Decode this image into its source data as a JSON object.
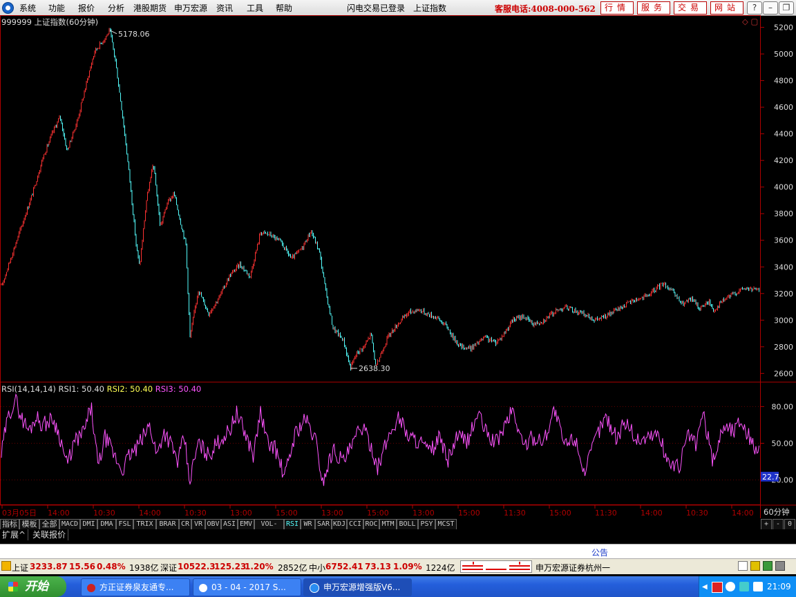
{
  "menu": [
    "系统",
    "功能",
    "报价",
    "分析",
    "港股期货",
    "申万宏源",
    "资讯",
    "工具",
    "帮助"
  ],
  "login_status": "闪电交易已登录",
  "index_name": "上证指数",
  "hotline": "客服电话:4008-000-562",
  "top_buttons": [
    "行情",
    "服务",
    "交易",
    "网站"
  ],
  "window_buttons": [
    "?",
    "–",
    "❐",
    "✕"
  ],
  "chart_title": "999999 上证指数(60分钟)",
  "max_marker": "5178.06",
  "min_marker": "2638.30",
  "period_label": "60分钟",
  "rsi_readout": {
    "name": "RSI(14,14,14)",
    "r1": "RSI1: 50.40",
    "r2": "RSI2: 50.40",
    "r3": "RSI3: 50.40"
  },
  "rsi_current": "22.7",
  "colors": {
    "up": "#ff3232",
    "down": "#54ffff",
    "rsi": "#ff54ff",
    "axis": "#b00000",
    "rsi2": "#ffff54"
  },
  "chart_data": {
    "type": "line",
    "price_ylim": [
      2550,
      5260
    ],
    "price_ticks": [
      "5200",
      "5000",
      "4800",
      "4600",
      "4400",
      "4200",
      "4000",
      "3800",
      "3600",
      "3400",
      "3200",
      "3000",
      "2800",
      "2600"
    ],
    "rsi_ylim": [
      0,
      100
    ],
    "rsi_ticks": [
      "80.00",
      "50.00",
      "20.00"
    ],
    "x_tick_labels": [
      "03月05日",
      "14:00",
      "10:30",
      "14:00",
      "10:30",
      "13:00",
      "15:00",
      "13:00",
      "15:00",
      "13:00",
      "15:00",
      "11:30",
      "15:00",
      "11:30",
      "14:00",
      "10:30",
      "14:00"
    ],
    "price_keypoints": [
      [
        0,
        3250
      ],
      [
        12,
        3440
      ],
      [
        30,
        3720
      ],
      [
        45,
        3950
      ],
      [
        60,
        4220
      ],
      [
        75,
        4420
      ],
      [
        85,
        4530
      ],
      [
        95,
        4270
      ],
      [
        110,
        4500
      ],
      [
        125,
        4820
      ],
      [
        135,
        5020
      ],
      [
        150,
        5120
      ],
      [
        157,
        5178
      ],
      [
        165,
        4950
      ],
      [
        175,
        4550
      ],
      [
        185,
        4100
      ],
      [
        195,
        3570
      ],
      [
        200,
        3400
      ],
      [
        210,
        3900
      ],
      [
        220,
        4180
      ],
      [
        230,
        3700
      ],
      [
        240,
        3880
      ],
      [
        250,
        3950
      ],
      [
        260,
        3720
      ],
      [
        267,
        3570
      ],
      [
        273,
        2870
      ],
      [
        285,
        3230
      ],
      [
        300,
        3050
      ],
      [
        315,
        3170
      ],
      [
        330,
        3330
      ],
      [
        345,
        3420
      ],
      [
        360,
        3330
      ],
      [
        375,
        3660
      ],
      [
        390,
        3640
      ],
      [
        405,
        3580
      ],
      [
        420,
        3460
      ],
      [
        435,
        3540
      ],
      [
        448,
        3670
      ],
      [
        460,
        3520
      ],
      [
        470,
        3200
      ],
      [
        480,
        2940
      ],
      [
        495,
        2850
      ],
      [
        505,
        2640
      ],
      [
        515,
        2760
      ],
      [
        525,
        2800
      ],
      [
        535,
        2900
      ],
      [
        542,
        2640
      ],
      [
        550,
        2760
      ],
      [
        560,
        2880
      ],
      [
        575,
        2980
      ],
      [
        590,
        3060
      ],
      [
        605,
        3080
      ],
      [
        615,
        3050
      ],
      [
        630,
        3020
      ],
      [
        645,
        2950
      ],
      [
        655,
        2860
      ],
      [
        665,
        2800
      ],
      [
        680,
        2790
      ],
      [
        700,
        2870
      ],
      [
        715,
        2830
      ],
      [
        725,
        2880
      ],
      [
        740,
        3000
      ],
      [
        755,
        3030
      ],
      [
        770,
        2970
      ],
      [
        785,
        3000
      ],
      [
        800,
        3060
      ],
      [
        815,
        3100
      ],
      [
        830,
        3070
      ],
      [
        845,
        3040
      ],
      [
        860,
        3000
      ],
      [
        875,
        3030
      ],
      [
        895,
        3090
      ],
      [
        915,
        3150
      ],
      [
        935,
        3180
      ],
      [
        958,
        3280
      ],
      [
        970,
        3220
      ],
      [
        985,
        3120
      ],
      [
        1000,
        3160
      ],
      [
        1010,
        3090
      ],
      [
        1025,
        3140
      ],
      [
        1030,
        3070
      ],
      [
        1045,
        3150
      ],
      [
        1060,
        3200
      ],
      [
        1075,
        3240
      ],
      [
        1090,
        3230
      ],
      [
        1099,
        3220
      ]
    ],
    "rsi_keypoints": [
      [
        0,
        40
      ],
      [
        6,
        62
      ],
      [
        12,
        75
      ],
      [
        20,
        86
      ],
      [
        30,
        70
      ],
      [
        40,
        60
      ],
      [
        50,
        72
      ],
      [
        60,
        65
      ],
      [
        75,
        70
      ],
      [
        85,
        55
      ],
      [
        95,
        32
      ],
      [
        105,
        50
      ],
      [
        120,
        60
      ],
      [
        130,
        80
      ],
      [
        140,
        30
      ],
      [
        150,
        55
      ],
      [
        165,
        38
      ],
      [
        175,
        28
      ],
      [
        185,
        40
      ],
      [
        195,
        45
      ],
      [
        205,
        55
      ],
      [
        215,
        65
      ],
      [
        225,
        40
      ],
      [
        235,
        60
      ],
      [
        245,
        50
      ],
      [
        255,
        35
      ],
      [
        265,
        55
      ],
      [
        272,
        18
      ],
      [
        285,
        50
      ],
      [
        300,
        40
      ],
      [
        315,
        52
      ],
      [
        330,
        60
      ],
      [
        340,
        75
      ],
      [
        355,
        55
      ],
      [
        365,
        40
      ],
      [
        375,
        76
      ],
      [
        385,
        50
      ],
      [
        395,
        48
      ],
      [
        410,
        22
      ],
      [
        425,
        58
      ],
      [
        440,
        70
      ],
      [
        455,
        52
      ],
      [
        465,
        18
      ],
      [
        480,
        45
      ],
      [
        495,
        35
      ],
      [
        510,
        50
      ],
      [
        520,
        65
      ],
      [
        535,
        48
      ],
      [
        545,
        30
      ],
      [
        560,
        55
      ],
      [
        575,
        72
      ],
      [
        590,
        55
      ],
      [
        605,
        52
      ],
      [
        620,
        42
      ],
      [
        635,
        55
      ],
      [
        645,
        35
      ],
      [
        660,
        55
      ],
      [
        675,
        52
      ],
      [
        690,
        75
      ],
      [
        700,
        60
      ],
      [
        715,
        50
      ],
      [
        725,
        60
      ],
      [
        740,
        78
      ],
      [
        755,
        48
      ],
      [
        770,
        55
      ],
      [
        785,
        52
      ],
      [
        800,
        78
      ],
      [
        815,
        48
      ],
      [
        830,
        55
      ],
      [
        845,
        25
      ],
      [
        860,
        55
      ],
      [
        875,
        72
      ],
      [
        890,
        55
      ],
      [
        905,
        68
      ],
      [
        920,
        52
      ],
      [
        935,
        55
      ],
      [
        950,
        58
      ],
      [
        965,
        35
      ],
      [
        980,
        30
      ],
      [
        995,
        58
      ],
      [
        1005,
        48
      ],
      [
        1015,
        75
      ],
      [
        1030,
        35
      ],
      [
        1045,
        65
      ],
      [
        1060,
        60
      ],
      [
        1070,
        70
      ],
      [
        1085,
        52
      ],
      [
        1099,
        40
      ]
    ]
  },
  "indicator_buttons": [
    "指标",
    "模板",
    "全部",
    "MACD",
    "DMI",
    "DMA",
    "FSL",
    "TRIX",
    "BRAR",
    "CR",
    "VR",
    "OBV",
    "ASI",
    "EMV",
    "VOL-TDX",
    "RSI",
    "WR",
    "SAR",
    "KDJ",
    "CCI",
    "ROC",
    "MTM",
    "BOLL",
    "PSY",
    "MCST"
  ],
  "zoom_buttons": [
    "+",
    "-",
    "0"
  ],
  "tabs": [
    "扩展^",
    "关联报价"
  ],
  "notice_text": "公告",
  "status": {
    "sh_label": "上证",
    "sh_val": "3233.87",
    "sh_chg": "15.56",
    "sh_pct": "0.48%",
    "sh_amt": "1938亿",
    "sz_label": "深证",
    "sz_val": "10522.3",
    "sz_chg": "125.23",
    "sz_pct": "1.20%",
    "sz_amt": "2852亿",
    "zx_label": "中小",
    "zx_val": "6752.41",
    "zx_chg": "73.13",
    "zx_pct": "1.09%",
    "zx_amt": "1224亿",
    "broker": "申万宏源证券杭州一"
  },
  "taskbar": {
    "start": "开始",
    "tasks": [
      "方正证券泉友通专...",
      "03 - 04 - 2017 S...",
      "申万宏源增强版V6..."
    ],
    "clock": "21:09"
  }
}
